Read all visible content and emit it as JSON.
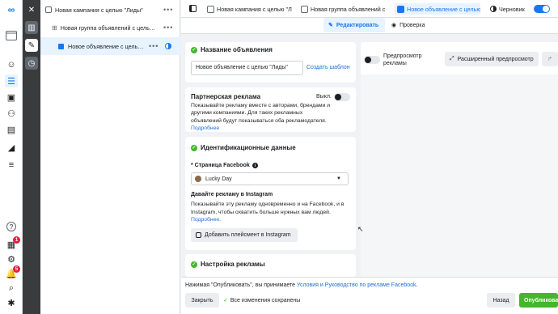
{
  "rail": {
    "logo": "meta-logo"
  },
  "tree": {
    "campaign": "Новая кампания с целью \"Лиды\"",
    "adset": "Новая группа объявлений с целью...",
    "ad": "Новое объявление с целью..."
  },
  "topbar": {
    "crumb_campaign": "Новая кампания с целью \"Л",
    "crumb_adset": "Новая группа объявлений с",
    "crumb_ad": "Новое объявление с целью \"",
    "status": "Черновик"
  },
  "modes": {
    "edit": "Редактировать",
    "review": "Проверка"
  },
  "ad_name": {
    "heading": "Название объявления",
    "value": "Новое объявление с целью \"Лиды\"",
    "create_template": "Создать шаблон"
  },
  "partner": {
    "heading": "Партнерская реклама",
    "toggle_label": "Выкл.",
    "text": "Показывайте рекламу вместе с авторами, брендами и другими компаниями. Для таких рекламных объявлений будут показываться оба рекламодателя.",
    "more": "Подробнее"
  },
  "identity": {
    "heading": "Идентификационные данные",
    "page_label": "* Страница Facebook",
    "page_value": "Lucky Day",
    "ig_heading": "Давайте рекламу в Instagram",
    "ig_text": "Показывайте эту рекламу одновременно и на Facebook, и в Instagram, чтобы охватить больше нужных вам людей.",
    "more": "Подробнее.",
    "add_placement": "Добавить плейсмент в Instagram"
  },
  "setup": {
    "heading": "Настройка рекламы"
  },
  "preview": {
    "toggle_label": "Предпросмотр рекламы",
    "advanced": "Расширенный предпросмотр"
  },
  "footer": {
    "notice_prefix": "Нажимая \"Опубликовать\", вы принимаете ",
    "notice_link": "Условия и Руководство по рекламе Facebook",
    "notice_suffix": ".",
    "close": "Закрыть",
    "saved": "Все изменения сохранены",
    "back": "Назад",
    "publish": "Опубликова"
  },
  "colors": {
    "accent": "#1877f2",
    "success": "#42b72a",
    "publish": "#42b72a"
  }
}
